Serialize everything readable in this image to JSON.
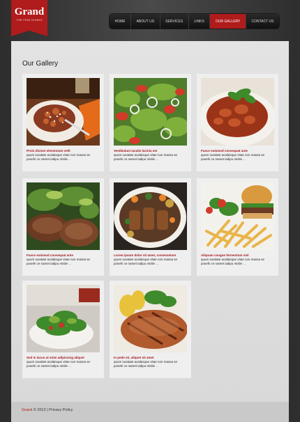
{
  "logo": {
    "title": "Grand",
    "subtitle": "THE FINE DINING"
  },
  "nav": [
    {
      "label": "Home",
      "active": false
    },
    {
      "label": "About Us",
      "active": false
    },
    {
      "label": "Services",
      "active": false
    },
    {
      "label": "Links",
      "active": false
    },
    {
      "label": "Our Gallery",
      "active": true
    },
    {
      "label": "Contact Us",
      "active": false
    }
  ],
  "page_title": "Our Gallery",
  "gallery": [
    {
      "title": "Proin dictum elementum velit",
      "text": "quum iuvatate acalaisque vitae non massa se posehi ce namet iadipu mislie",
      "more": "...",
      "photo": "pasta-dish"
    },
    {
      "title": "Vestibulum iaculis lacinia est",
      "text": "quum iuvatate acalaisque vitae non massa se posehi ce namet iadipu mislie",
      "more": "...",
      "photo": "green-salad"
    },
    {
      "title": "Fusce euismod consequat ante",
      "text": "quum iuvatate acalaisque vitae non massa se posehi ce namet iadipu mislie",
      "more": "...",
      "photo": "stew-with-basil"
    },
    {
      "title": "Fusce euismod consequat ante",
      "text": "quum iuvatate acalaisque vitae non massa se posehi ce namet iadipu mislie",
      "more": "...",
      "photo": "steak-with-greens"
    },
    {
      "title": "Lorem ipsum dolor sit amet, consectetuer",
      "text": "quum iuvatate acalaisque vitae non massa se posehi ce namet iadipu mislie",
      "more": "...",
      "photo": "grilled-meat-platter"
    },
    {
      "title": "Aliquam congue fermentum nisl",
      "text": "quum iuvatate acalaisque vitae non massa se posehi ce namet iadipu mislie",
      "more": "...",
      "photo": "burger-and-fries"
    },
    {
      "title": "Sed in lacus ut enim adipiscing aliquet",
      "text": "quum iuvatate acalaisque vitae non massa se posehi ce namet iadipu mislie",
      "more": "...",
      "photo": "bowl-salad"
    },
    {
      "title": "In pede mi, aliquet sit amet",
      "text": "quum iuvatate acalaisque vitae non massa se posehi ce namet iadipu mislie",
      "more": "...",
      "photo": "grilled-chicken-with-corn"
    }
  ],
  "footer": {
    "brand": "Grand",
    "copyright": "© 2012",
    "separator": "|",
    "privacy": "Privacy Policy"
  }
}
